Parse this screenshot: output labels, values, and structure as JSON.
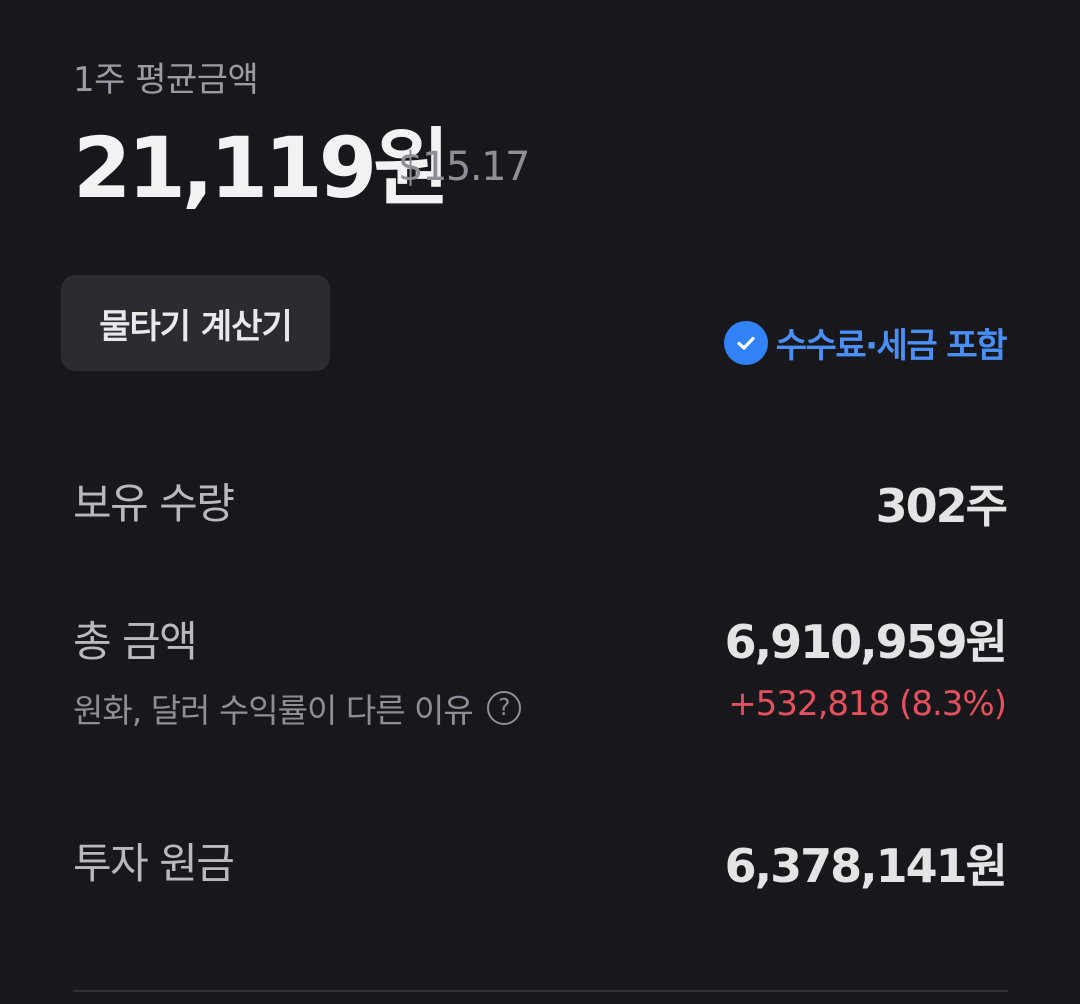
{
  "average": {
    "label": "1주 평균금액",
    "price_krw": "21,119원",
    "price_usd": "$15.17"
  },
  "calculator": {
    "label": "물타기 계산기"
  },
  "fee_notice": {
    "label": "수수료·세금 포함",
    "icon": "check-circle-icon",
    "color": "#3182f6"
  },
  "holdings": {
    "label": "보유 수량",
    "value": "302주"
  },
  "total": {
    "label": "총 금액",
    "value": "6,910,959원",
    "sub_label": "원화, 달러 수익률이 다른 이유",
    "help_icon": "?",
    "profit": "+532,818 (8.3%)",
    "profit_color": "#e5505d"
  },
  "principal": {
    "label": "투자 원금",
    "value": "6,378,141원"
  }
}
